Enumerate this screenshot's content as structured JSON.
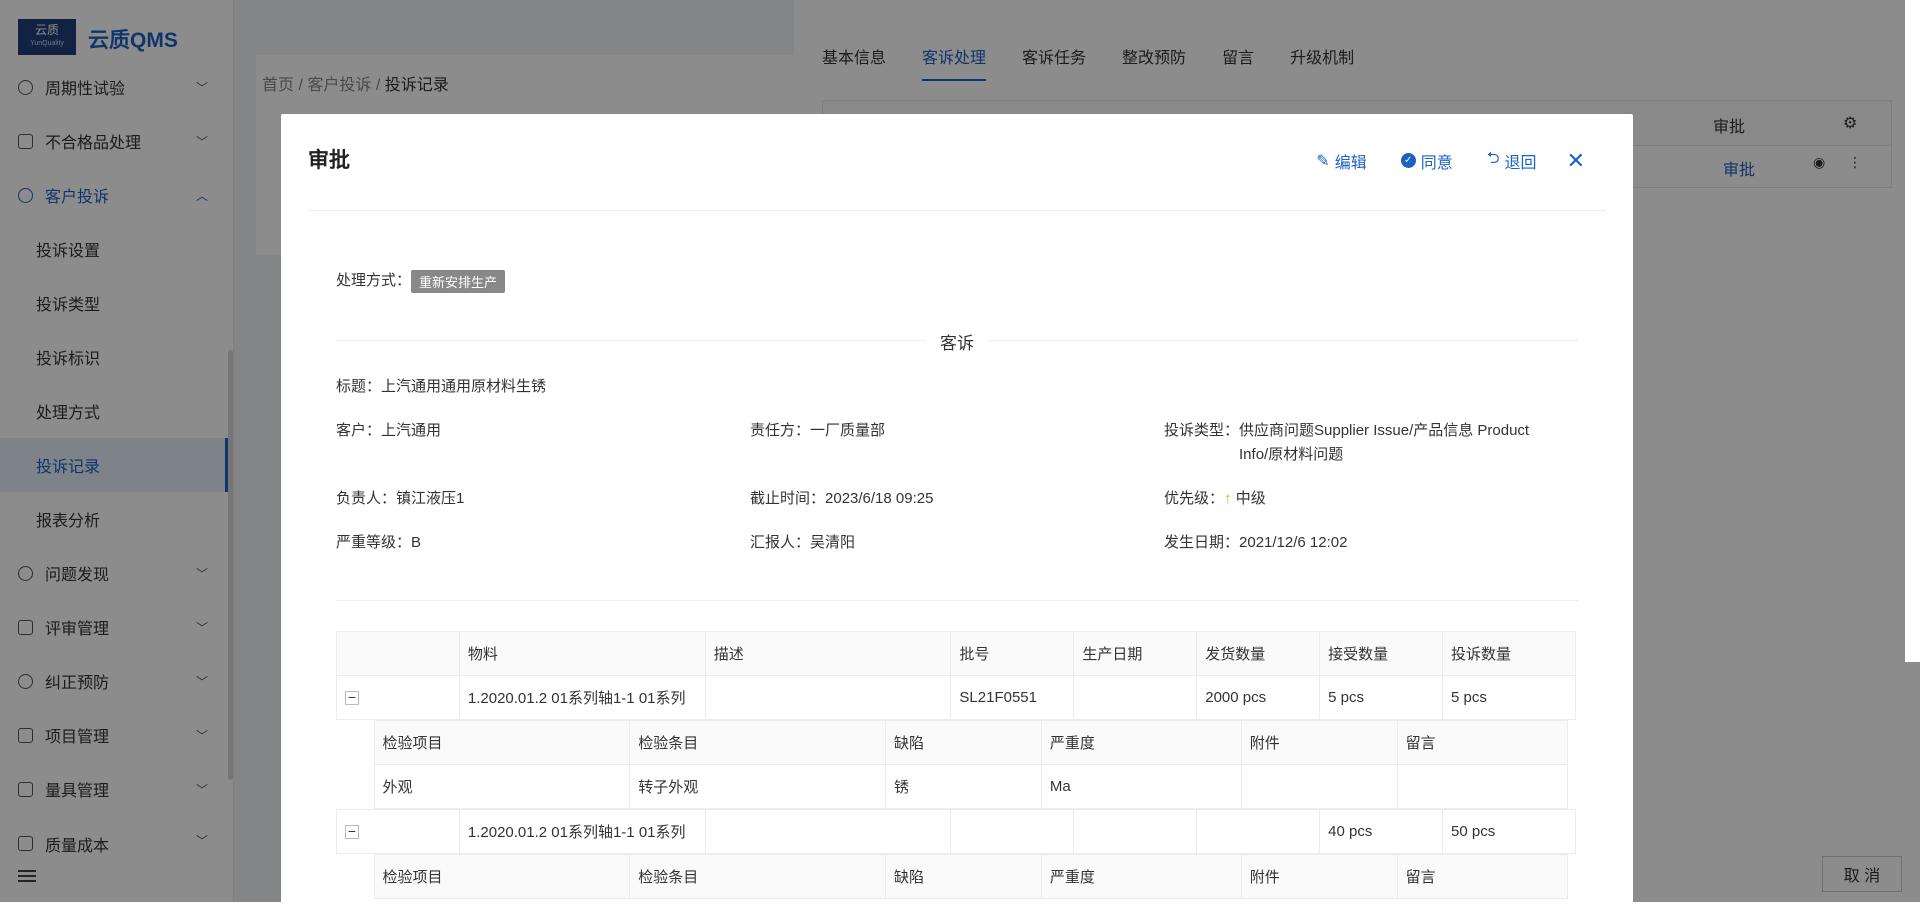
{
  "app": {
    "logo_main": "云质",
    "logo_sub": "YunQuality",
    "title": "云质QMS"
  },
  "sidebar": {
    "items": [
      {
        "label": "周期性试验"
      },
      {
        "label": "不合格品处理"
      },
      {
        "label": "客户投诉"
      },
      {
        "label": "问题发现"
      },
      {
        "label": "评审管理"
      },
      {
        "label": "纠正预防"
      },
      {
        "label": "项目管理"
      },
      {
        "label": "量具管理"
      },
      {
        "label": "质量成本"
      }
    ],
    "sub_items": [
      {
        "label": "投诉设置"
      },
      {
        "label": "投诉类型"
      },
      {
        "label": "投诉标识"
      },
      {
        "label": "处理方式"
      },
      {
        "label": "投诉记录"
      },
      {
        "label": "报表分析"
      }
    ]
  },
  "breadcrumb": {
    "home": "首页",
    "parent": "客户投诉",
    "current": "投诉记录"
  },
  "background": {
    "tabs": [
      "基本信息",
      "客诉处理",
      "客诉任务",
      "整改预防",
      "留言",
      "升级机制"
    ],
    "col_header": "审批",
    "row_action": "审批",
    "cancel": "取 消"
  },
  "modal": {
    "title": "审批",
    "edit": "编辑",
    "approve": "同意",
    "return": "退回",
    "method_label": "处理方式：",
    "method_value": "重新安排生产",
    "section": "客诉",
    "title_label": "标题：",
    "title_value": "上汽通用通用原材料生锈",
    "customer_label": "客户：",
    "customer_value": "上汽通用",
    "responsible_label": "责任方：",
    "responsible_value": "一厂质量部",
    "type_label": "投诉类型：",
    "type_value": "供应商问题Supplier Issue/产品信息 Product Info/原材料问题",
    "owner_label": "负责人：",
    "owner_value": "镇江液压1",
    "deadline_label": "截止时间：",
    "deadline_value": "2023/6/18 09:25",
    "priority_label": "优先级：",
    "priority_value": "中级",
    "severity_label": "严重等级：",
    "severity_value": "B",
    "reporter_label": "汇报人：",
    "reporter_value": "吴清阳",
    "date_label": "发生日期：",
    "date_value": "2021/12/6 12:02"
  },
  "table": {
    "headers": [
      "",
      "物料",
      "描述",
      "批号",
      "生产日期",
      "发货数量",
      "接受数量",
      "投诉数量"
    ],
    "rows": [
      {
        "material": "1.2020.01.2 01系列轴1-1 01系列",
        "desc": "",
        "batch": "SL21F0551",
        "prod_date": "",
        "shipped": "2000 pcs",
        "accepted": "5 pcs",
        "complaints": "5 pcs",
        "sub": {
          "headers": [
            "检验项目",
            "检验条目",
            "缺陷",
            "严重度",
            "附件",
            "留言"
          ],
          "rows": [
            [
              "外观",
              "转子外观",
              "锈",
              "Ma",
              "",
              ""
            ]
          ]
        }
      },
      {
        "material": "1.2020.01.2 01系列轴1-1 01系列",
        "desc": "",
        "batch": "",
        "prod_date": "",
        "shipped": "",
        "accepted": "40 pcs",
        "complaints": "50 pcs",
        "sub": {
          "headers": [
            "检验项目",
            "检验条目",
            "缺陷",
            "严重度",
            "附件",
            "留言"
          ],
          "rows": []
        }
      }
    ]
  }
}
